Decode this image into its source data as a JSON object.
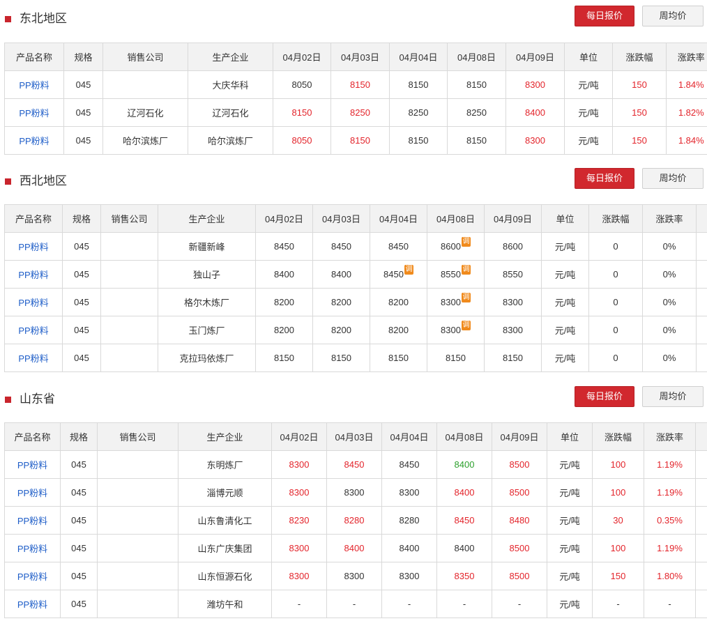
{
  "sections": [
    {
      "title": "东北地区",
      "btn_daily": "每日报价",
      "btn_week": "周均价",
      "headers": [
        "产品名称",
        "规格",
        "销售公司",
        "生产企业",
        "04月02日",
        "04月03日",
        "04月04日",
        "04月08日",
        "04月09日",
        "单位",
        "涨跌幅",
        "涨跌率"
      ],
      "rows": [
        {
          "product": "PP粉料",
          "spec": "045",
          "seller": "",
          "producer": "大庆华科",
          "p0402": "8050",
          "p0403": "8150",
          "p0404": "8150",
          "p0408": "8150",
          "p0409": "8300",
          "unit": "元/吨",
          "change": "150",
          "rate": "1.84%"
        },
        {
          "product": "PP粉料",
          "spec": "045",
          "seller": "辽河石化",
          "producer": "辽河石化",
          "p0402": "8150",
          "p0403": "8250",
          "p0404": "8250",
          "p0408": "8250",
          "p0409": "8400",
          "unit": "元/吨",
          "change": "150",
          "rate": "1.82%"
        },
        {
          "product": "PP粉料",
          "spec": "045",
          "seller": "哈尔滨炼厂",
          "producer": "哈尔滨炼厂",
          "p0402": "8050",
          "p0403": "8150",
          "p0404": "8150",
          "p0408": "8150",
          "p0409": "8300",
          "unit": "元/吨",
          "change": "150",
          "rate": "1.84%"
        }
      ]
    },
    {
      "title": "西北地区",
      "btn_daily": "每日报价",
      "btn_week": "周均价",
      "headers": [
        "产品名称",
        "规格",
        "销售公司",
        "生产企业",
        "04月02日",
        "04月03日",
        "04月04日",
        "04月08日",
        "04月09日",
        "单位",
        "涨跌幅",
        "涨跌率"
      ],
      "adjust_badge": "调",
      "rows": [
        {
          "product": "PP粉料",
          "spec": "045",
          "seller": "",
          "producer": "新疆新峰",
          "p0402": "8450",
          "p0403": "8450",
          "p0404": "8450",
          "p0408": "8600",
          "p0409": "8600",
          "unit": "元/吨",
          "change": "0",
          "rate": "0%"
        },
        {
          "product": "PP粉料",
          "spec": "045",
          "seller": "",
          "producer": "独山子",
          "p0402": "8400",
          "p0403": "8400",
          "p0404": "8450",
          "p0408": "8550",
          "p0409": "8550",
          "unit": "元/吨",
          "change": "0",
          "rate": "0%"
        },
        {
          "product": "PP粉料",
          "spec": "045",
          "seller": "",
          "producer": "格尔木炼厂",
          "p0402": "8200",
          "p0403": "8200",
          "p0404": "8200",
          "p0408": "8300",
          "p0409": "8300",
          "unit": "元/吨",
          "change": "0",
          "rate": "0%"
        },
        {
          "product": "PP粉料",
          "spec": "045",
          "seller": "",
          "producer": "玉门炼厂",
          "p0402": "8200",
          "p0403": "8200",
          "p0404": "8200",
          "p0408": "8300",
          "p0409": "8300",
          "unit": "元/吨",
          "change": "0",
          "rate": "0%"
        },
        {
          "product": "PP粉料",
          "spec": "045",
          "seller": "",
          "producer": "克拉玛依炼厂",
          "p0402": "8150",
          "p0403": "8150",
          "p0404": "8150",
          "p0408": "8150",
          "p0409": "8150",
          "unit": "元/吨",
          "change": "0",
          "rate": "0%"
        }
      ]
    },
    {
      "title": "山东省",
      "btn_daily": "每日报价",
      "btn_week": "周均价",
      "headers": [
        "产品名称",
        "规格",
        "销售公司",
        "生产企业",
        "04月02日",
        "04月03日",
        "04月04日",
        "04月08日",
        "04月09日",
        "单位",
        "涨跌幅",
        "涨跌率"
      ],
      "rows": [
        {
          "product": "PP粉料",
          "spec": "045",
          "seller": "",
          "producer": "东明炼厂",
          "p0402": "8300",
          "p0403": "8450",
          "p0404": "8450",
          "p0408": "8400",
          "p0409": "8500",
          "unit": "元/吨",
          "change": "100",
          "rate": "1.19%"
        },
        {
          "product": "PP粉料",
          "spec": "045",
          "seller": "",
          "producer": "淄博元顺",
          "p0402": "8300",
          "p0403": "8300",
          "p0404": "8300",
          "p0408": "8400",
          "p0409": "8500",
          "unit": "元/吨",
          "change": "100",
          "rate": "1.19%"
        },
        {
          "product": "PP粉料",
          "spec": "045",
          "seller": "",
          "producer": "山东鲁清化工",
          "p0402": "8230",
          "p0403": "8280",
          "p0404": "8280",
          "p0408": "8450",
          "p0409": "8480",
          "unit": "元/吨",
          "change": "30",
          "rate": "0.35%"
        },
        {
          "product": "PP粉料",
          "spec": "045",
          "seller": "",
          "producer": "山东广庆集团",
          "p0402": "8300",
          "p0403": "8400",
          "p0404": "8400",
          "p0408": "8400",
          "p0409": "8500",
          "unit": "元/吨",
          "change": "100",
          "rate": "1.19%"
        },
        {
          "product": "PP粉料",
          "spec": "045",
          "seller": "",
          "producer": "山东恒源石化",
          "p0402": "8300",
          "p0403": "8300",
          "p0404": "8300",
          "p0408": "8350",
          "p0409": "8500",
          "unit": "元/吨",
          "change": "150",
          "rate": "1.80%"
        },
        {
          "product": "PP粉料",
          "spec": "045",
          "seller": "",
          "producer": "潍坊午和",
          "p0402": "-",
          "p0403": "-",
          "p0404": "-",
          "p0408": "-",
          "p0409": "-",
          "unit": "元/吨",
          "change": "-",
          "rate": "-"
        }
      ]
    }
  ],
  "colors": {
    "accent": "#d1282e",
    "up": "#e3242b",
    "down": "#2ca02c",
    "link": "#1f5ec8",
    "header_bg": "#f2f2f2",
    "border": "#d9d9d9"
  }
}
